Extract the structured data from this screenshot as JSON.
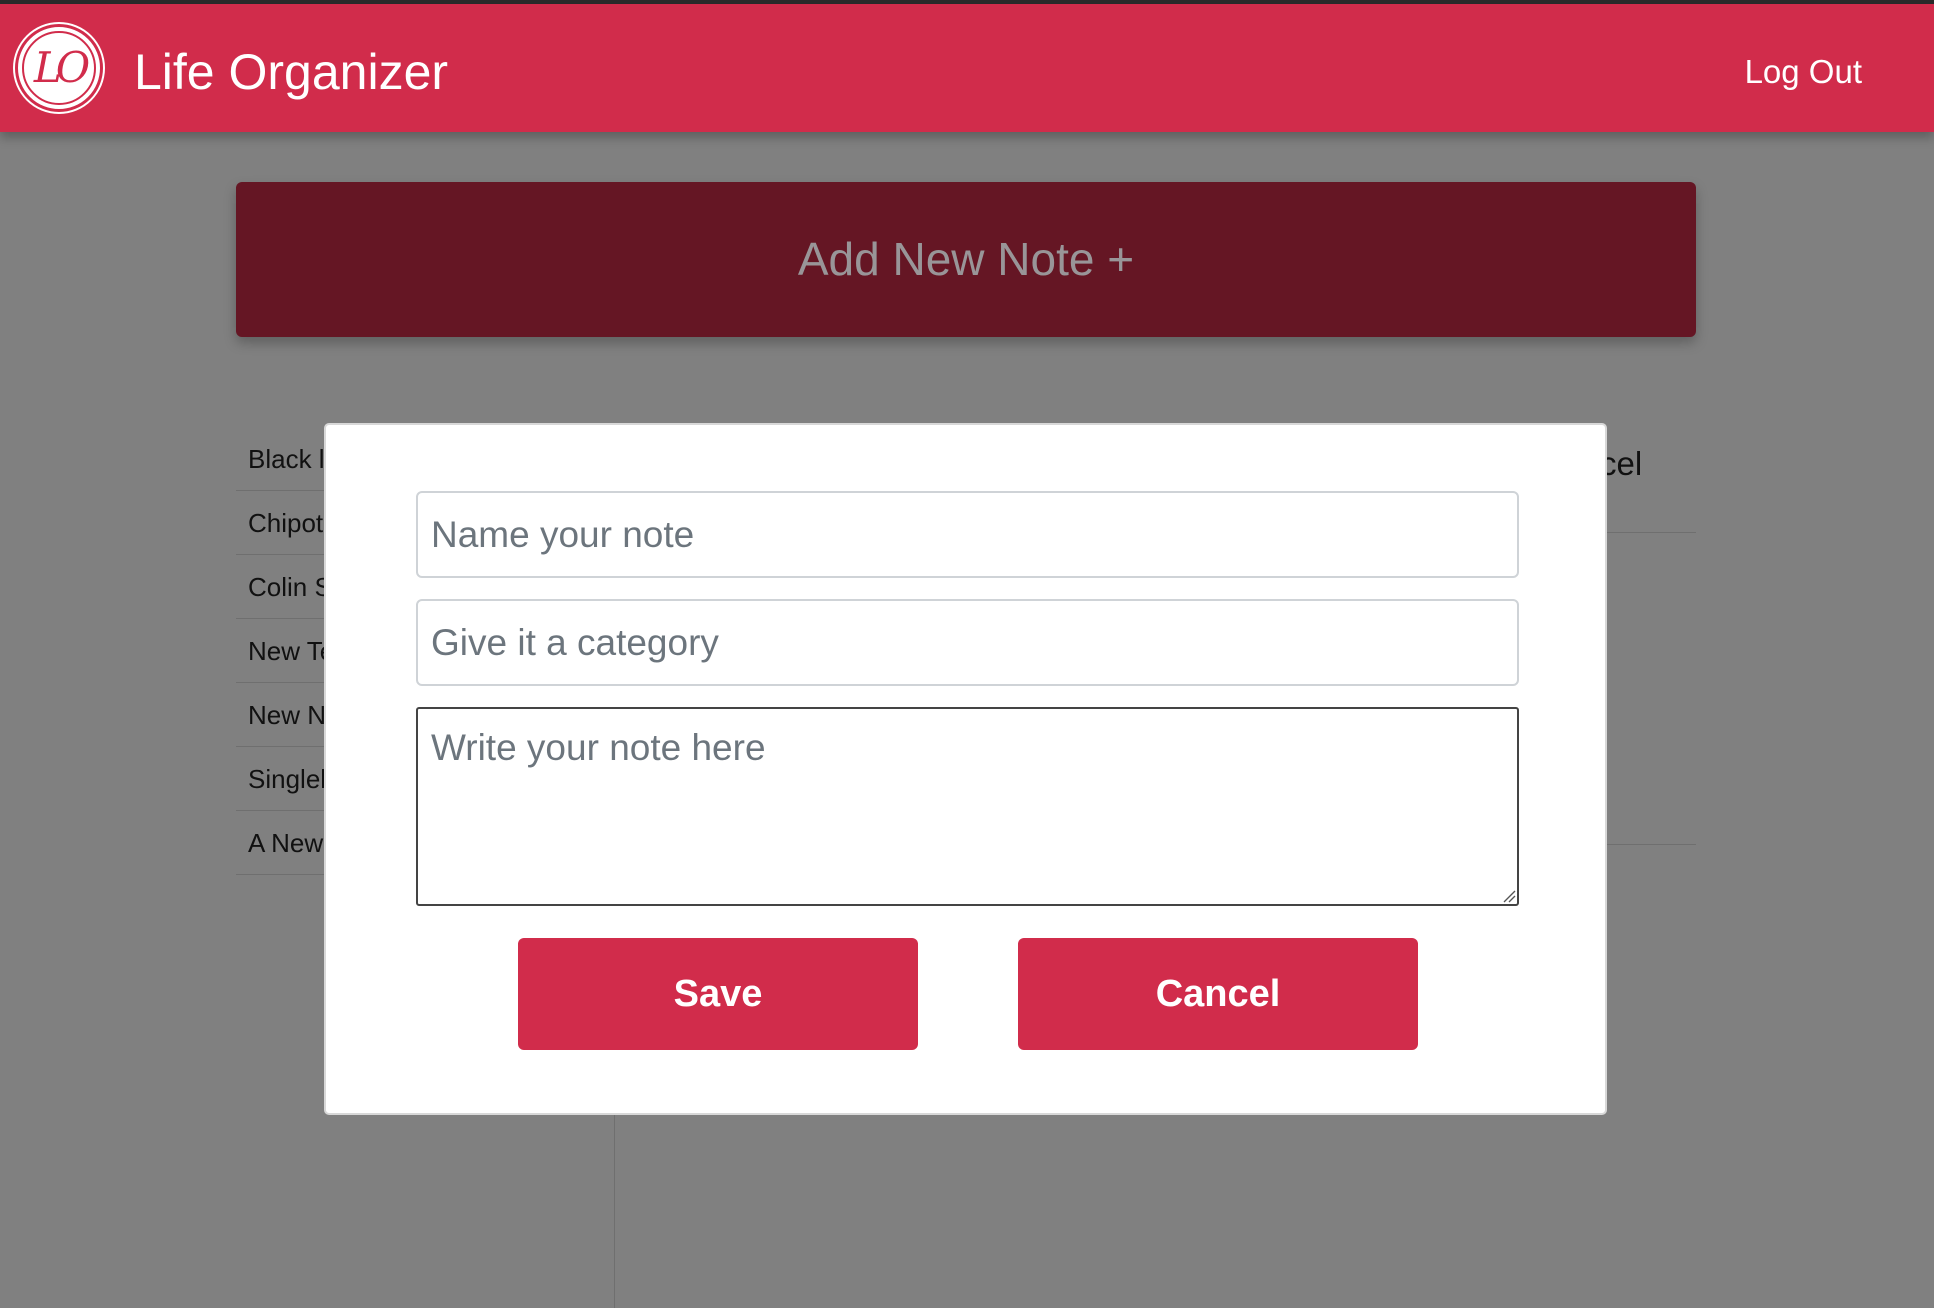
{
  "header": {
    "logo_text": "LO",
    "app_title": "Life Organizer",
    "logout_label": "Log Out"
  },
  "add_note": {
    "label": "Add New Note +"
  },
  "background": {
    "note_list": [
      "Black l",
      "Chipot",
      "Colin S",
      "New Te",
      "New N",
      "Singlel",
      "A New"
    ],
    "partial_cancel_text": "cel"
  },
  "modal": {
    "name_placeholder": "Name your note",
    "category_placeholder": "Give it a category",
    "body_placeholder": "Write your note here",
    "save_label": "Save",
    "cancel_label": "Cancel"
  },
  "colors": {
    "brand_red": "#d12c4b",
    "dark_red": "#651624",
    "overlay_gray": "#808080"
  }
}
